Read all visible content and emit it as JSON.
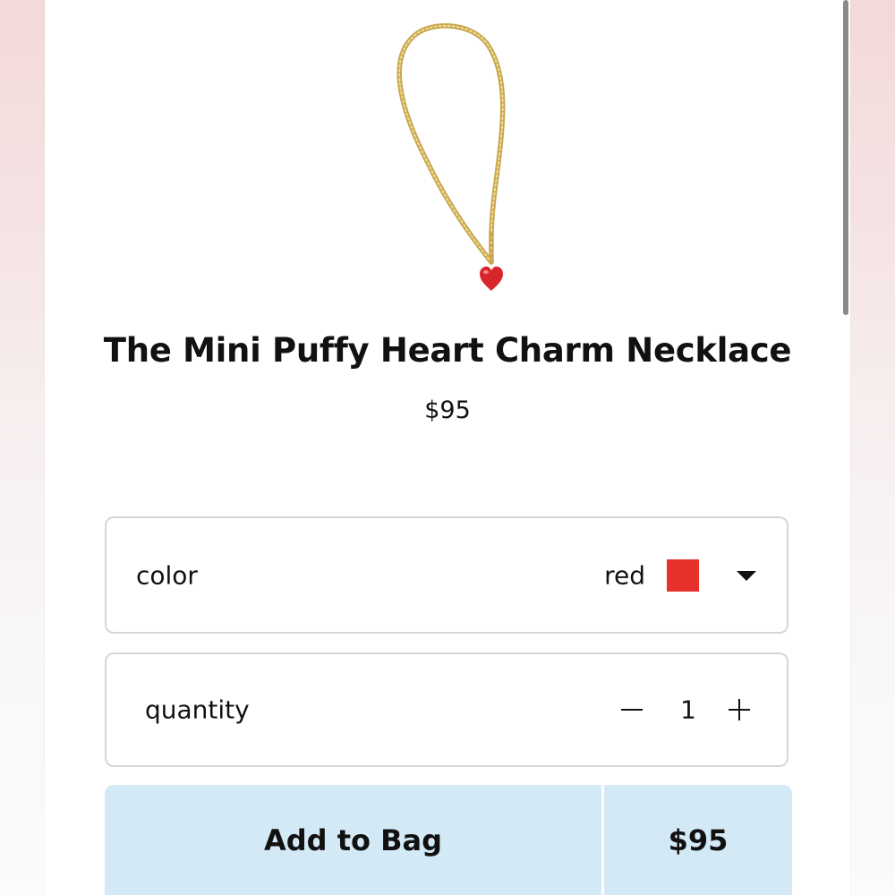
{
  "product": {
    "title": "The Mini Puffy Heart Charm Necklace",
    "price": "$95",
    "image": {
      "chain_color": "#c9a64e",
      "charm_color": "#d9262b",
      "icon": "heart-necklace-image"
    }
  },
  "options": {
    "color": {
      "label": "color",
      "value": "red",
      "swatch_color": "#e8302c",
      "icon": "chevron-down-icon"
    },
    "quantity": {
      "label": "quantity",
      "value": "1",
      "decrement_icon": "minus-icon",
      "increment_icon": "plus-icon"
    }
  },
  "cta": {
    "add_label": "Add to Bag",
    "price": "$95",
    "background": "#d4e9f6"
  }
}
